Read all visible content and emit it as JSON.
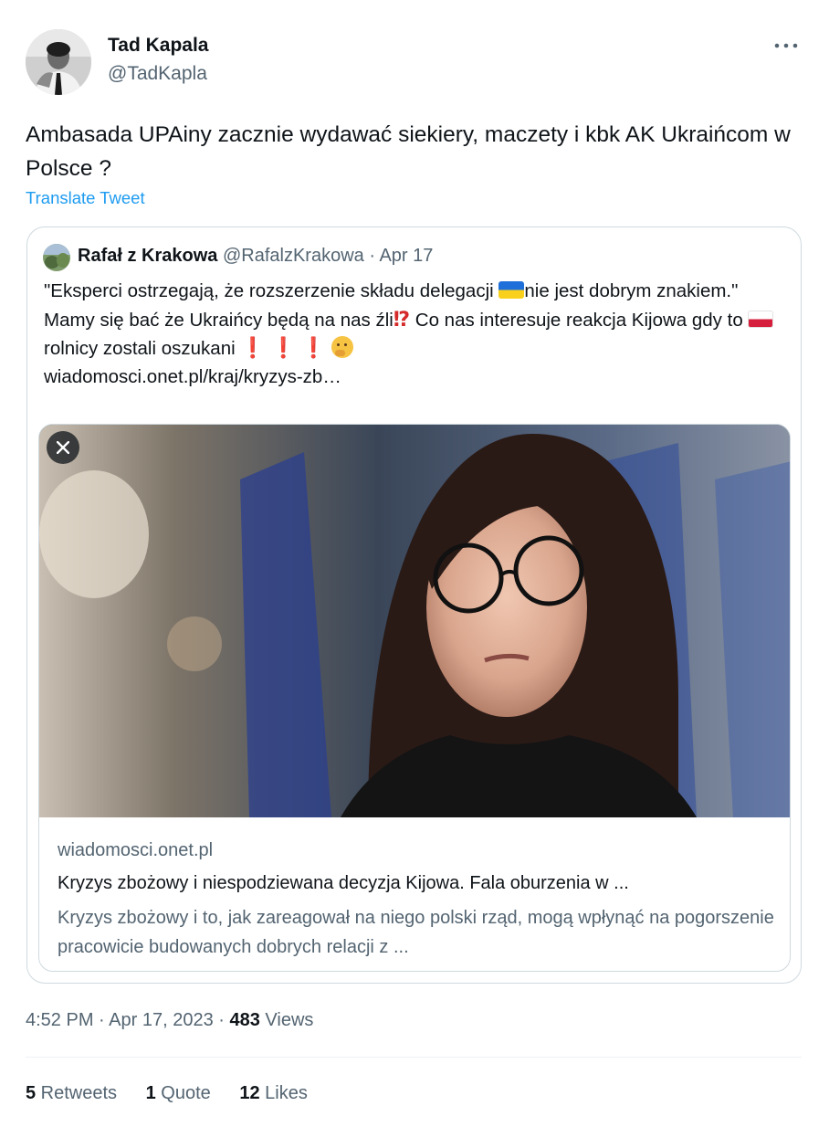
{
  "author": {
    "name": "Tad Kapala",
    "handle": "@TadKapla"
  },
  "tweet": {
    "text": "Ambasada UPAiny zacznie wydawać siekiery, maczety i kbk AK Ukraińcom w Polsce ?",
    "translate_label": "Translate Tweet"
  },
  "quoted": {
    "name": "Rafał z Krakowa",
    "handle": "@RafalzKrakowa",
    "separator": " · ",
    "date": "Apr 17",
    "text": {
      "part1": "\"Eksperci ostrzegają, że rozszerzenie składu delegacji ",
      "part2": "nie jest dobrym znakiem.\" Mamy się bać że Ukraińcy będą na nas źli",
      "part3": " Co nas interesuje reakcja Kijowa gdy to ",
      "part4": " rolnicy zostali oszukani",
      "link": "wiadomosci.onet.pl/kraj/kryzys-zb…"
    },
    "emojis": {
      "flag_ua": "flag-ukraine-icon",
      "interrobang": "⁉",
      "exclamation": "❗",
      "flag_pl": "flag-poland-icon",
      "thinking": "thinking-face-icon"
    },
    "link_card": {
      "domain": "wiadomosci.onet.pl",
      "title": "Kryzys zbożowy i niespodziewana decyzja Kijowa. Fala oburzenia w ...",
      "description": "Kryzys zbożowy i to, jak zareagował na niego polski rząd, mogą wpłynąć na pogorszenie pracowicie budowanych dobrych relacji z ..."
    }
  },
  "meta": {
    "time": "4:52 PM",
    "sep1": " · ",
    "date": "Apr 17, 2023",
    "sep2": " · ",
    "views_count": "483",
    "views_label": " Views"
  },
  "stats": {
    "retweets_count": "5",
    "retweets_label": " Retweets",
    "quotes_count": "1",
    "quotes_label": " Quote",
    "likes_count": "12",
    "likes_label": " Likes"
  },
  "colors": {
    "text": "#0f1419",
    "secondary": "#536471",
    "link": "#1d9bf0",
    "border": "#cfd9de"
  }
}
